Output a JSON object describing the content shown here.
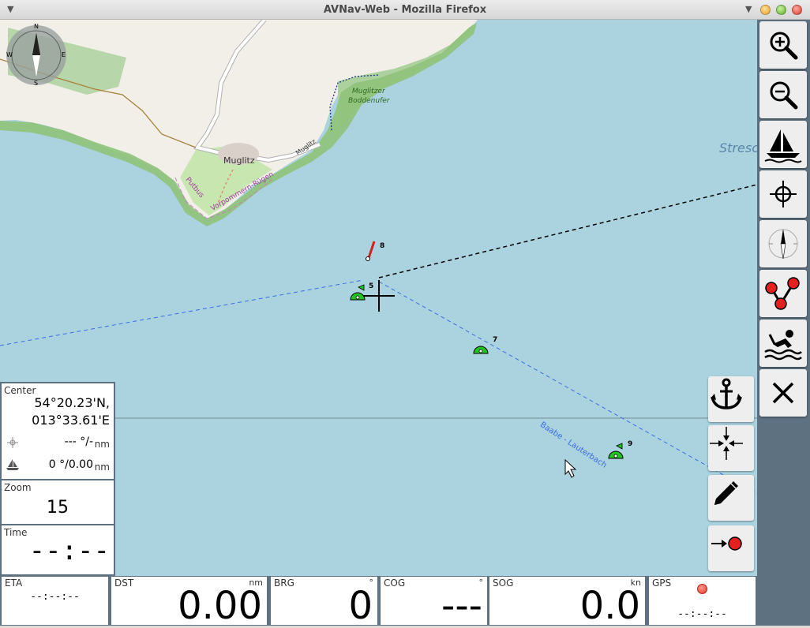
{
  "window": {
    "title": "AVNav-Web - Mozilla Firefox"
  },
  "map": {
    "place_labels": {
      "town": "Muglitz",
      "road": "Muglitz",
      "nature_1": "Muglitzer",
      "nature_2": "Boddenufer",
      "admin_1": "Putbus",
      "admin_2": "Vorpommern-Rügen",
      "offscreen_town": "Stresc",
      "route": "Baabe - Lauterbach"
    },
    "buoys": [
      "8",
      "5",
      "7",
      "9"
    ],
    "compass": {
      "n": "N",
      "e": "E",
      "s": "S",
      "w": "W"
    }
  },
  "sidebar": {
    "buttons": [
      "zoom-in",
      "zoom-out",
      "boat",
      "center-on-gps",
      "compass",
      "route-editor",
      "mob",
      "close"
    ]
  },
  "map_buttons": [
    "anchor",
    "center",
    "edit",
    "goto-waypoint"
  ],
  "left_panels": {
    "center": {
      "label": "Center",
      "lat": "54°20.23'N,",
      "lon": "013°33.61'E",
      "marker_value": "--- °/-",
      "marker_unit": "nm",
      "boat_value": "0 °/0.00",
      "boat_unit": "nm"
    },
    "zoom": {
      "label": "Zoom",
      "value": "15"
    },
    "time": {
      "label": "Time",
      "value": "--:--"
    }
  },
  "bottom_panels": {
    "eta": {
      "label": "ETA",
      "value": "--:--:--"
    },
    "dst": {
      "label": "DST",
      "unit": "nm",
      "value": "0.00"
    },
    "brg": {
      "label": "BRG",
      "unit": "°",
      "value": "0"
    },
    "cog": {
      "label": "COG",
      "unit": "°",
      "value": "---"
    },
    "sog": {
      "label": "SOG",
      "unit": "kn",
      "value": "0.0"
    },
    "gps": {
      "label": "GPS",
      "value": "--:--:--",
      "status_color": "#e53a2a"
    }
  },
  "colors": {
    "water": "#aad3df",
    "land": "#f2efe9",
    "bar": "#5d7180",
    "buoy": "#22c422"
  }
}
